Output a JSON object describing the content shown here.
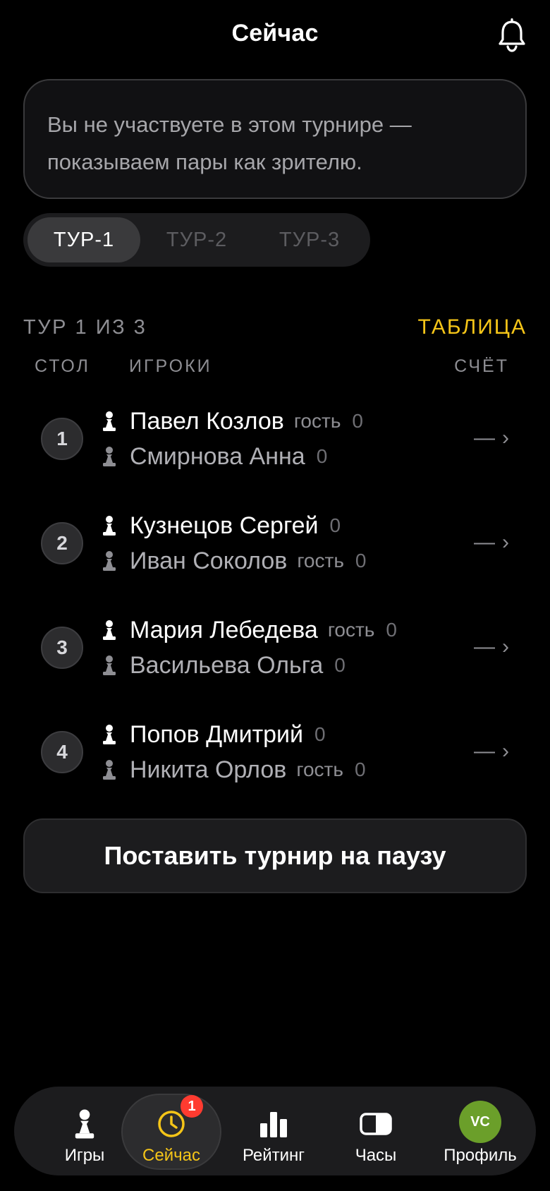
{
  "header": {
    "title": "Сейчас",
    "bell_icon": "bell-icon"
  },
  "notice": {
    "text": "Вы не участвуете в этом турнире — показываем пары как зрителю."
  },
  "round_tabs": [
    {
      "label": "ТУР-1",
      "active": true
    },
    {
      "label": "ТУР-2",
      "active": false
    },
    {
      "label": "ТУР-3",
      "active": false
    }
  ],
  "round_info": {
    "label": "ТУР 1 ИЗ 3",
    "table_link": "ТАБЛИЦА",
    "accent_color": "#f5c518"
  },
  "columns": {
    "table": "СТОЛ",
    "players": "ИГРОКИ",
    "score": "СЧЁТ"
  },
  "pairs": [
    {
      "table": "1",
      "white": {
        "name": "Павел Козлов",
        "guest": "гость",
        "points": "0"
      },
      "black": {
        "name": "Смирнова Анна",
        "guest": "",
        "points": "0"
      },
      "score": "—"
    },
    {
      "table": "2",
      "white": {
        "name": "Кузнецов Сергей",
        "guest": "",
        "points": "0"
      },
      "black": {
        "name": "Иван Соколов",
        "guest": "гость",
        "points": "0"
      },
      "score": "—"
    },
    {
      "table": "3",
      "white": {
        "name": "Мария Лебедева",
        "guest": "гость",
        "points": "0"
      },
      "black": {
        "name": "Васильева Ольга",
        "guest": "",
        "points": "0"
      },
      "score": "—"
    },
    {
      "table": "4",
      "white": {
        "name": "Попов Дмитрий",
        "guest": "",
        "points": "0"
      },
      "black": {
        "name": "Никита Орлов",
        "guest": "гость",
        "points": "0"
      },
      "score": "—"
    }
  ],
  "pause_button": {
    "label": "Поставить турнир на паузу"
  },
  "tabbar": {
    "items": [
      {
        "label": "Игры",
        "icon": "pawn-icon"
      },
      {
        "label": "Сейчас",
        "icon": "clock-icon",
        "badge": "1",
        "active": true
      },
      {
        "label": "Рейтинг",
        "icon": "bar-chart-icon"
      },
      {
        "label": "Часы",
        "icon": "chess-clock-icon"
      },
      {
        "label": "Профиль",
        "icon": "avatar",
        "initials": "VC"
      }
    ]
  },
  "colors": {
    "background": "#000000",
    "card": "#1c1c1e",
    "accent": "#f5c518",
    "badge": "#ff3b30",
    "avatar": "#6b9f2a"
  }
}
